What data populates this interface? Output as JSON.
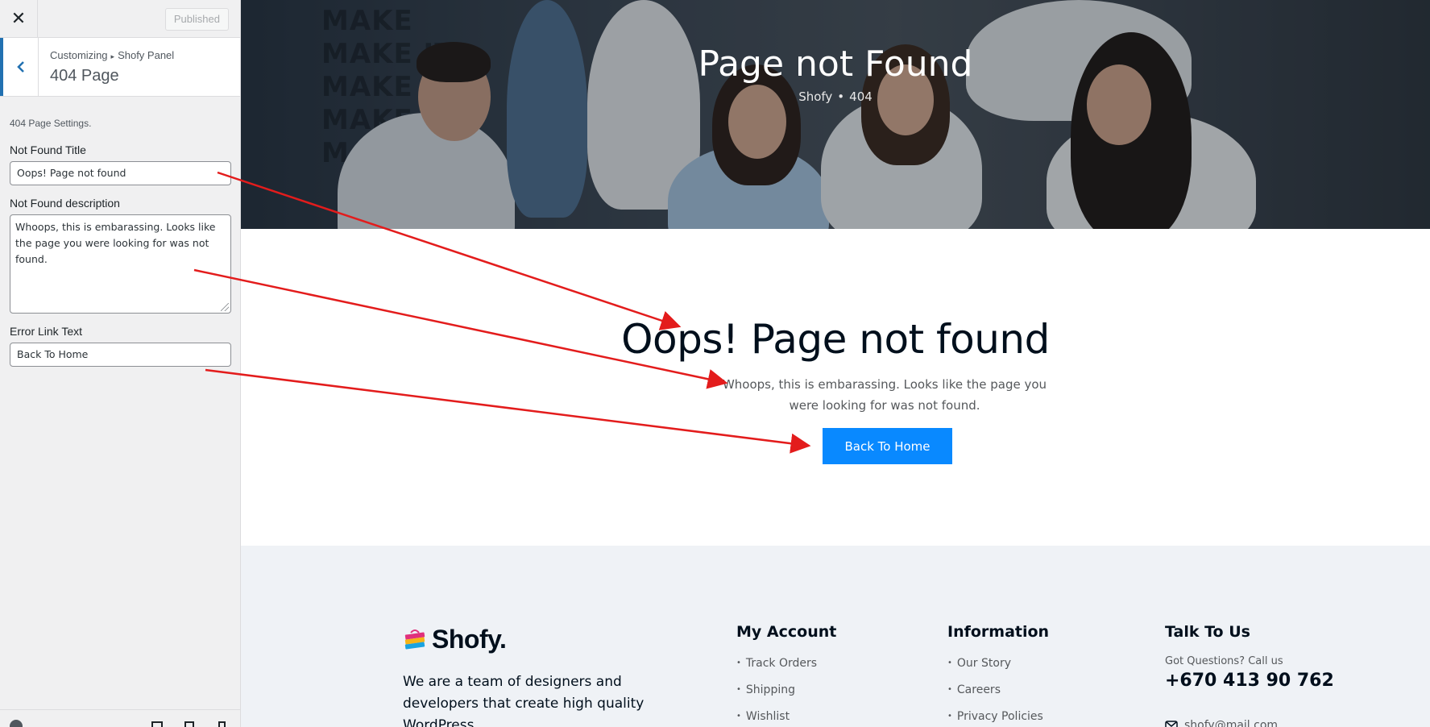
{
  "customizer": {
    "close_icon": "close-icon",
    "published_label": "Published",
    "breadcrumb_root": "Customizing",
    "breadcrumb_parent": "Shofy Panel",
    "section_title": "404 Page",
    "settings_note": "404 Page Settings.",
    "not_found_title_label": "Not Found Title",
    "not_found_title_value": "Oops! Page not found",
    "not_found_desc_label": "Not Found description",
    "not_found_desc_value": "Whoops, this is embarassing. Looks like the page you were looking for was not found.",
    "error_link_label": "Error Link Text",
    "error_link_value": "Back To Home"
  },
  "preview": {
    "hero": {
      "title": "Page not Found",
      "crumb_home": "Shofy",
      "crumb_bullet": "•",
      "crumb_current": "404",
      "wall_lines": [
        "MAKE",
        "MAKE IT",
        "MAKE IT",
        "MAKE IT",
        "MAKE IT"
      ]
    },
    "not_found": {
      "title": "Oops! Page not found",
      "description": "Whoops, this is embarassing. Looks like the page you were looking for was not found.",
      "button": "Back To Home"
    },
    "footer": {
      "logo_text": "Shofy.",
      "about": "We are a team of designers and developers that create high quality WordPress",
      "my_account_title": "My Account",
      "my_account": [
        "Track Orders",
        "Shipping",
        "Wishlist"
      ],
      "information_title": "Information",
      "information": [
        "Our Story",
        "Careers",
        "Privacy Policies"
      ],
      "talk_title": "Talk To Us",
      "talk_question": "Got Questions? Call us",
      "talk_phone": "+670 413 90 762",
      "talk_email": "shofy@mail.com"
    }
  },
  "colors": {
    "accent_blue": "#0989ff",
    "wp_blue": "#2271b1",
    "annotation_red": "#e31c1c",
    "heading_dark": "#010f1c"
  }
}
